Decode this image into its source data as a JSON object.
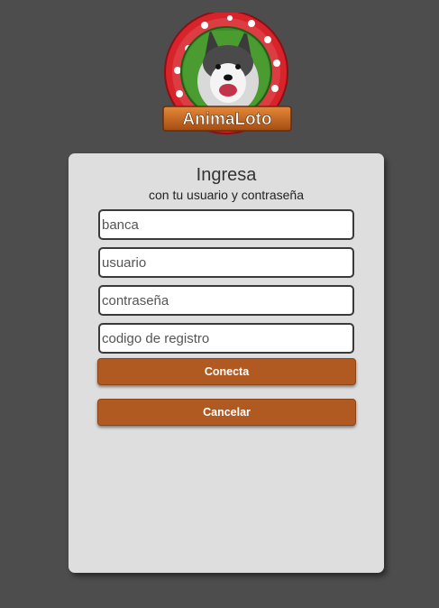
{
  "logo": {
    "brand_text": "AnimaLoto"
  },
  "login": {
    "title": "Ingresa",
    "subtitle": "con tu usuario y contraseña",
    "fields": {
      "banca_placeholder": "banca",
      "usuario_placeholder": "usuario",
      "password_placeholder": "contraseña",
      "registro_placeholder": "codigo de registro"
    },
    "connect_label": "Conecta",
    "cancel_label": "Cancelar"
  },
  "colors": {
    "background": "#4d4d4d",
    "card": "#dedede",
    "button": "#b05a22",
    "logo_ring": "#d8232a",
    "logo_banner": "#c8651c"
  }
}
